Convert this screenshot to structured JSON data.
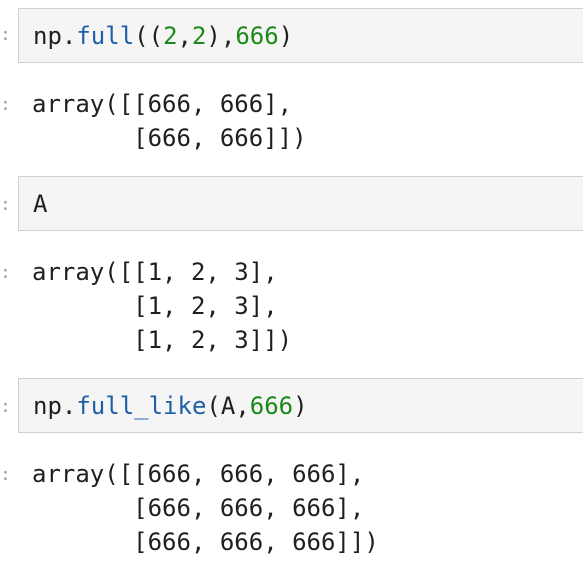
{
  "cells": [
    {
      "input": {
        "obj": "np",
        "dot": ".",
        "func": "full",
        "open": "((",
        "arg1": "2",
        "comma1": ",",
        "arg2": "2",
        "close1": "),",
        "fill": "666",
        "close2": ")"
      },
      "output": "array([[666, 666],\n       [666, 666]])"
    },
    {
      "input": {
        "var": "A"
      },
      "output": "array([[1, 2, 3],\n       [1, 2, 3],\n       [1, 2, 3]])"
    },
    {
      "input": {
        "obj": "np",
        "dot": ".",
        "func": "full_like",
        "open": "(",
        "arg1": "A",
        "comma1": ",",
        "fill": "666",
        "close2": ")"
      },
      "output": "array([[666, 666, 666],\n       [666, 666, 666],\n       [666, 666, 666]])"
    }
  ],
  "colors": {
    "function": "#1f5fa8",
    "number": "#1a8a1a",
    "cell_bg": "#f5f5f5",
    "cell_border": "#d0d0d0"
  }
}
